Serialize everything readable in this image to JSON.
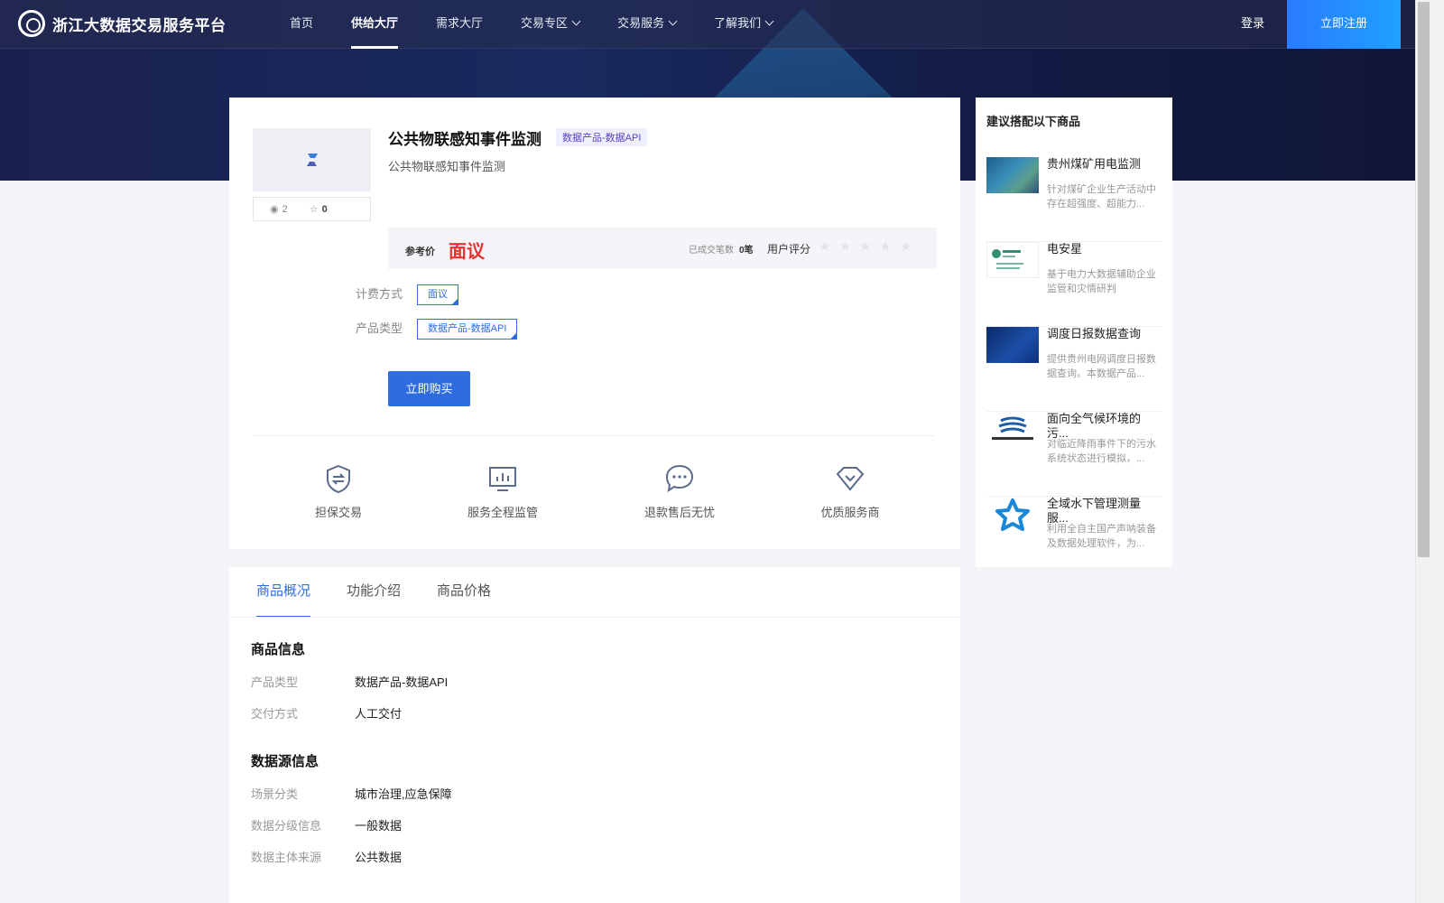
{
  "header": {
    "logo_text": "浙江大数据交易服务平台",
    "nav": [
      {
        "label": "首页",
        "dropdown": false
      },
      {
        "label": "供给大厅",
        "dropdown": false,
        "active": true
      },
      {
        "label": "需求大厅",
        "dropdown": false
      },
      {
        "label": "交易专区",
        "dropdown": true
      },
      {
        "label": "交易服务",
        "dropdown": true
      },
      {
        "label": "了解我们",
        "dropdown": true
      }
    ],
    "login": "登录",
    "register": "立即注册"
  },
  "product": {
    "title": "公共物联感知事件监测",
    "tag": "数据产品-数据API",
    "subtitle": "公共物联感知事件监测",
    "views": "2",
    "favorites": "0",
    "price_label": "参考价",
    "price_value": "面议",
    "deals_label": "已成交笔数",
    "deals_value": "0笔",
    "rating_label": "用户评分",
    "rating_stars": 0,
    "billing_label": "计费方式",
    "billing_value": "面议",
    "type_label": "产品类型",
    "type_value": "数据产品-数据API",
    "buy_button": "立即购买",
    "features": [
      "担保交易",
      "服务全程监管",
      "退款售后无忧",
      "优质服务商"
    ]
  },
  "sidebar": {
    "title": "建议搭配以下商品",
    "items": [
      {
        "title": "贵州煤矿用电监测",
        "desc": "针对煤矿企业生产活动中存在超强度、超能力..."
      },
      {
        "title": "电安星",
        "desc": "基于电力大数据辅助企业监管和灾情研判"
      },
      {
        "title": "调度日报数据查询",
        "desc": "提供贵州电网调度日报数据查询。本数据产品..."
      },
      {
        "title": "面向全气候环境的污...",
        "desc": "对临近降雨事件下的污水系统状态进行模拟，..."
      },
      {
        "title": "全域水下管理测量服...",
        "desc": "利用全自主国产声呐装备及数据处理软件，为..."
      }
    ]
  },
  "detail": {
    "tabs": [
      "商品概况",
      "功能介绍",
      "商品价格"
    ],
    "section1_title": "商品信息",
    "section1_rows": [
      {
        "k": "产品类型",
        "v": "数据产品-数据API"
      },
      {
        "k": "交付方式",
        "v": "人工交付"
      }
    ],
    "section2_title": "数据源信息",
    "section2_rows": [
      {
        "k": "场景分类",
        "v": "城市治理,应急保障"
      },
      {
        "k": "数据分级信息",
        "v": "一般数据"
      },
      {
        "k": "数据主体来源",
        "v": "公共数据"
      }
    ]
  }
}
